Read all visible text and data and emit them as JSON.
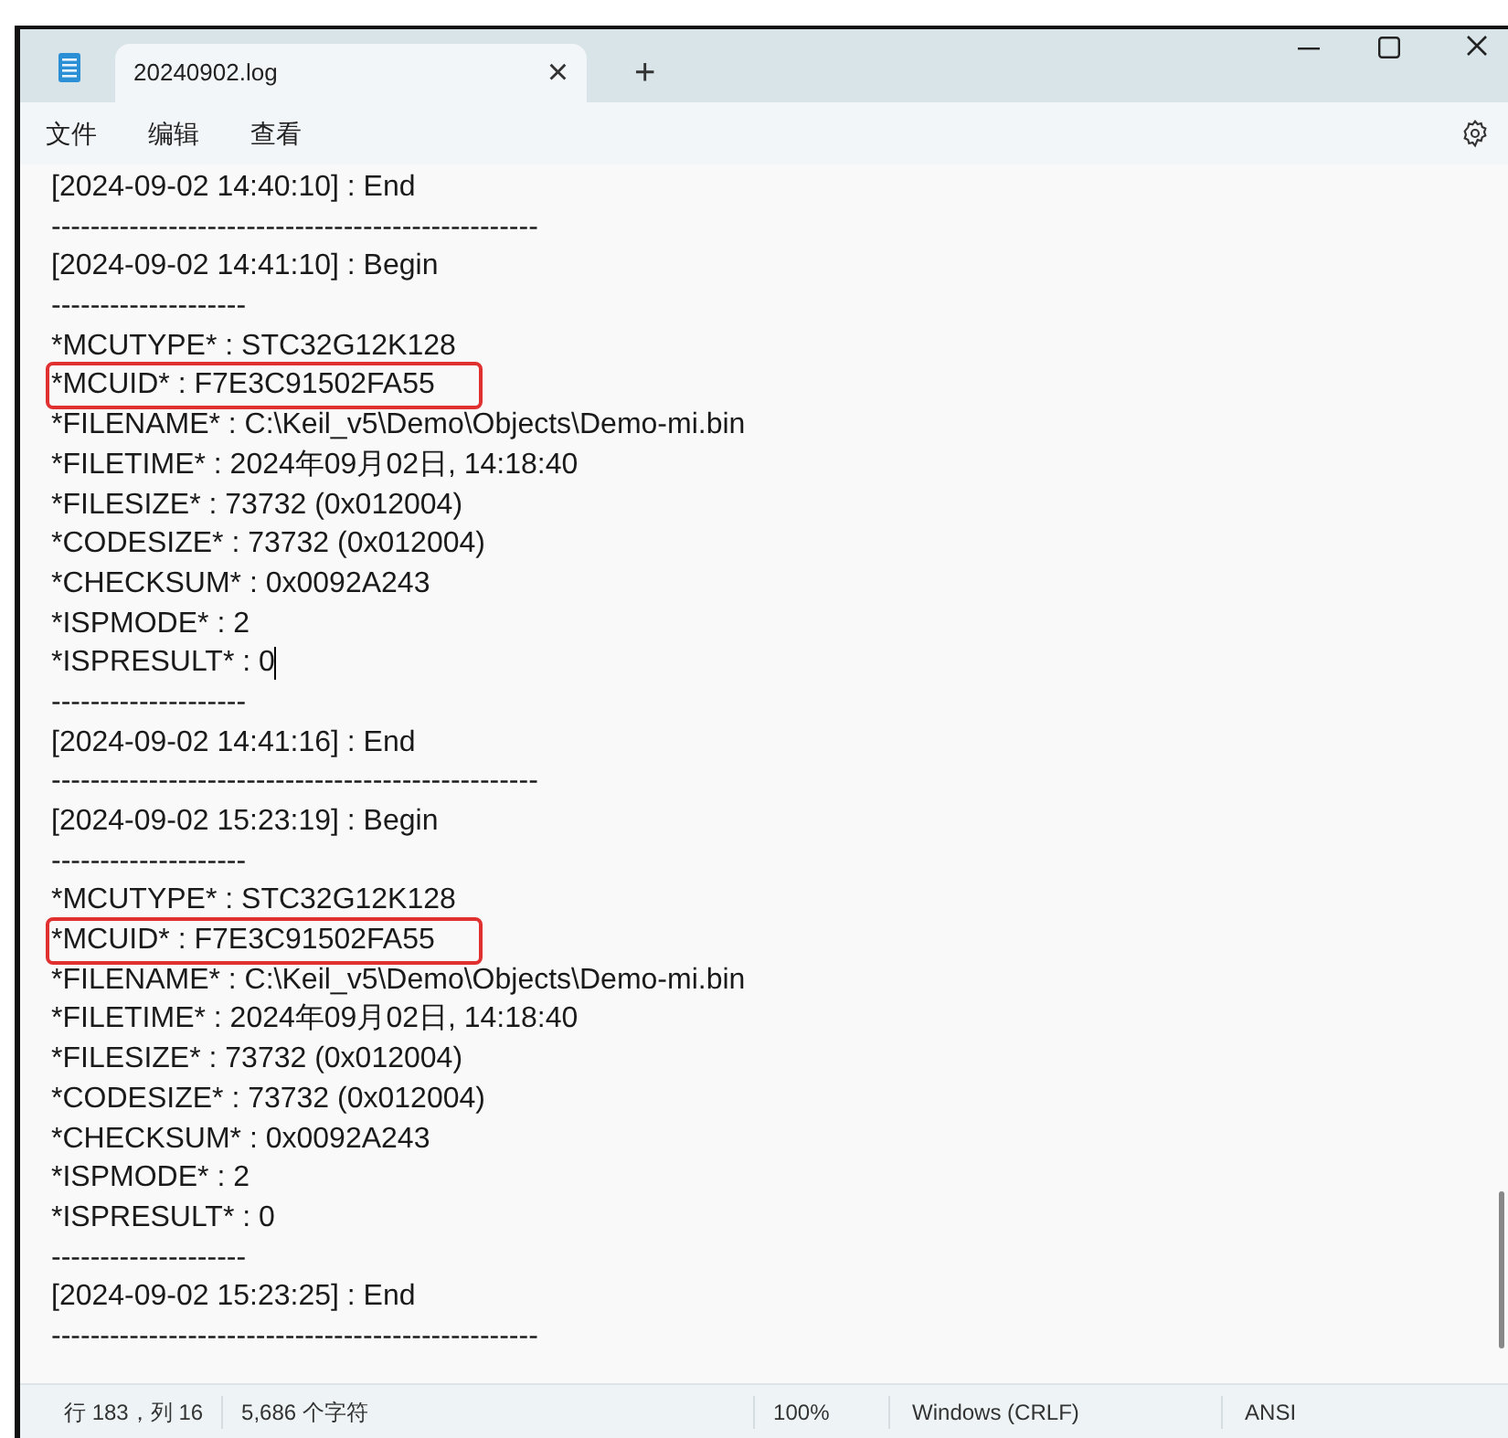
{
  "window": {
    "tab_title": "20240902.log",
    "tab_close": "×",
    "new_tab": "+"
  },
  "menu": [
    "文件",
    "编辑",
    "查看"
  ],
  "lines": [
    {
      "text": "[2024-09-02 14:40:10] : End",
      "highlighted": false,
      "cursor": false
    },
    {
      "text": "--------------------------------------------------",
      "highlighted": false,
      "cursor": false
    },
    {
      "text": "[2024-09-02 14:41:10] : Begin",
      "highlighted": false,
      "cursor": false
    },
    {
      "text": "--------------------",
      "highlighted": false,
      "cursor": false
    },
    {
      "text": "*MCUTYPE* : STC32G12K128",
      "highlighted": false,
      "cursor": false
    },
    {
      "text": "*MCUID* : F7E3C91502FA55",
      "highlighted": true,
      "cursor": false
    },
    {
      "text": "*FILENAME* : C:\\Keil_v5\\Demo\\Objects\\Demo-mi.bin",
      "highlighted": false,
      "cursor": false
    },
    {
      "text": "*FILETIME* : 2024年09月02日, 14:18:40",
      "highlighted": false,
      "cursor": false
    },
    {
      "text": "*FILESIZE* : 73732 (0x012004)",
      "highlighted": false,
      "cursor": false
    },
    {
      "text": "*CODESIZE* : 73732 (0x012004)",
      "highlighted": false,
      "cursor": false
    },
    {
      "text": "*CHECKSUM* : 0x0092A243",
      "highlighted": false,
      "cursor": false
    },
    {
      "text": "*ISPMODE* : 2",
      "highlighted": false,
      "cursor": false
    },
    {
      "text": "*ISPRESULT* : 0",
      "highlighted": false,
      "cursor": true
    },
    {
      "text": "--------------------",
      "highlighted": false,
      "cursor": false
    },
    {
      "text": "[2024-09-02 14:41:16] : End",
      "highlighted": false,
      "cursor": false
    },
    {
      "text": "--------------------------------------------------",
      "highlighted": false,
      "cursor": false
    },
    {
      "text": "[2024-09-02 15:23:19] : Begin",
      "highlighted": false,
      "cursor": false
    },
    {
      "text": "--------------------",
      "highlighted": false,
      "cursor": false
    },
    {
      "text": "*MCUTYPE* : STC32G12K128",
      "highlighted": false,
      "cursor": false
    },
    {
      "text": "*MCUID* : F7E3C91502FA55",
      "highlighted": true,
      "cursor": false
    },
    {
      "text": "*FILENAME* : C:\\Keil_v5\\Demo\\Objects\\Demo-mi.bin",
      "highlighted": false,
      "cursor": false
    },
    {
      "text": "*FILETIME* : 2024年09月02日, 14:18:40",
      "highlighted": false,
      "cursor": false
    },
    {
      "text": "*FILESIZE* : 73732 (0x012004)",
      "highlighted": false,
      "cursor": false
    },
    {
      "text": "*CODESIZE* : 73732 (0x012004)",
      "highlighted": false,
      "cursor": false
    },
    {
      "text": "*CHECKSUM* : 0x0092A243",
      "highlighted": false,
      "cursor": false
    },
    {
      "text": "*ISPMODE* : 2",
      "highlighted": false,
      "cursor": false
    },
    {
      "text": "*ISPRESULT* : 0",
      "highlighted": false,
      "cursor": false
    },
    {
      "text": "--------------------",
      "highlighted": false,
      "cursor": false
    },
    {
      "text": "[2024-09-02 15:23:25] : End",
      "highlighted": false,
      "cursor": false
    },
    {
      "text": "--------------------------------------------------",
      "highlighted": false,
      "cursor": false
    }
  ],
  "status_bar": {
    "position": "行 183，列 16",
    "characters": "5,686 个字符",
    "zoom": "100%",
    "line_ending": "Windows (CRLF)",
    "encoding": "ANSI"
  }
}
